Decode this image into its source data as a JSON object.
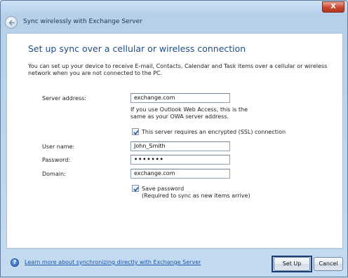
{
  "window": {
    "title": "Sync wirelessly with Exchange Server",
    "close_glyph": "X"
  },
  "page": {
    "heading": "Set up sync over a cellular or wireless connection",
    "description": "You can set up your device to receive E-mail, Contacts, Calendar and Task items over a cellular or wireless network when you are not connected to the PC."
  },
  "form": {
    "server_label": "Server address:",
    "server_value": "exchange.com",
    "server_hint_line1": "If you use Outlook Web Access, this is the",
    "server_hint_line2": "same as your OWA server address.",
    "ssl_label": "This server requires an encrypted (SSL) connection",
    "ssl_checked": true,
    "username_label": "User name:",
    "username_value": "John_Smith",
    "password_label": "Password:",
    "password_value": "•••••••",
    "domain_label": "Domain:",
    "domain_value": "exchange.com",
    "save_password_label": "Save password",
    "save_password_note": "(Required to sync as new items arrive)",
    "save_password_checked": true
  },
  "footer": {
    "help_link": "Learn more about synchronizing directly with Exchange Server",
    "help_icon": "?",
    "setup_button": "Set Up",
    "cancel_button": "Cancel"
  },
  "icons": {
    "back": "back-arrow-icon",
    "help": "help-icon",
    "check": "check-icon"
  },
  "colors": {
    "heading": "#1f4e86",
    "link": "#1a55a7",
    "close": "#c9452e",
    "focus_border": "#1d3e78"
  }
}
